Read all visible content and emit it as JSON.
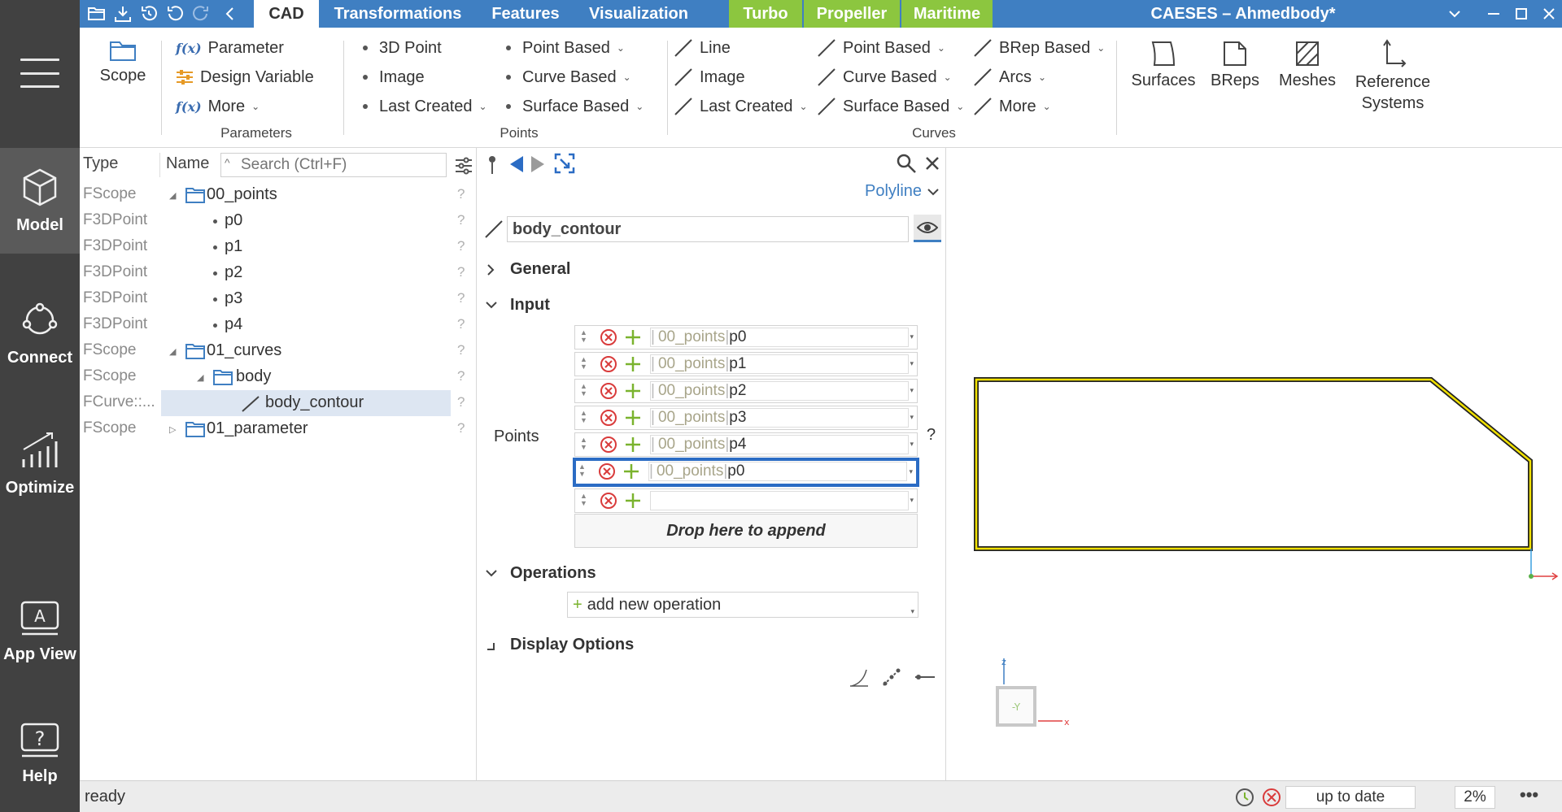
{
  "titlebar": {
    "tabs": [
      {
        "label": "CAD",
        "active": true
      },
      {
        "label": "Transformations"
      },
      {
        "label": "Features"
      },
      {
        "label": "Visualization"
      },
      {
        "label": "Turbo",
        "accent": "#8cc63f"
      },
      {
        "label": "Propeller",
        "accent": "#8cc63f"
      },
      {
        "label": "Maritime",
        "accent": "#8cc63f"
      }
    ],
    "app_title": "CAESES – Ahmedbody*",
    "quick_icons": [
      "open-folder-icon",
      "save-icon",
      "history-icon",
      "undo-icon",
      "redo-icon",
      "back-icon"
    ],
    "window_controls": [
      "chevron-down-icon",
      "minimize-icon",
      "maximize-icon",
      "close-icon"
    ],
    "bar_color": "#3f7fc2"
  },
  "sidebar": {
    "items": [
      {
        "label": "Model",
        "icon": "cube-icon",
        "active": true
      },
      {
        "label": "Connect",
        "icon": "connect-icon"
      },
      {
        "label": "Optimize",
        "icon": "chart-icon"
      },
      {
        "label": "App View",
        "icon": "app-view-icon"
      },
      {
        "label": "Help",
        "icon": "help-icon"
      }
    ]
  },
  "ribbon": {
    "scope": "Scope",
    "parameters": {
      "items": [
        "Parameter",
        "Design Variable",
        "More"
      ],
      "fx": "f(x)",
      "group": "Parameters"
    },
    "points": {
      "col1": [
        "3D Point",
        "Image",
        "Last Created"
      ],
      "col2": [
        "Point Based",
        "Curve Based",
        "Surface Based"
      ],
      "group": "Points"
    },
    "curves": {
      "col1": [
        "Line",
        "Image",
        "Last Created"
      ],
      "col2": [
        "Point Based",
        "Curve Based",
        "Surface Based"
      ],
      "col3": [
        "BRep Based",
        "Arcs",
        "More"
      ],
      "group": "Curves"
    },
    "big": [
      "Surfaces",
      "BReps",
      "Meshes",
      "Reference Systems"
    ]
  },
  "tree": {
    "col_type": "Type",
    "col_name": "Name",
    "search_placeholder": "Search (Ctrl+F)",
    "rows": [
      {
        "type": "FScope",
        "name": "00_points"
      },
      {
        "type": "F3DPoint",
        "name": "p0"
      },
      {
        "type": "F3DPoint",
        "name": "p1"
      },
      {
        "type": "F3DPoint",
        "name": "p2"
      },
      {
        "type": "F3DPoint",
        "name": "p3"
      },
      {
        "type": "F3DPoint",
        "name": "p4"
      },
      {
        "type": "FScope",
        "name": "01_curves"
      },
      {
        "type": "FScope",
        "name": "body"
      },
      {
        "type": "FCurve::...",
        "name": "body_contour"
      },
      {
        "type": "FScope",
        "name": "01_parameter"
      }
    ],
    "help_mark": "?"
  },
  "props": {
    "curve_type": "Polyline",
    "object_name": "body_contour",
    "sections": {
      "general": "General",
      "input": "Input",
      "operations": "Operations",
      "display": "Display Options"
    },
    "points_label": "Points",
    "points_help": "?",
    "points": [
      {
        "scope": "00_points",
        "value": "p0"
      },
      {
        "scope": "00_points",
        "value": "p1"
      },
      {
        "scope": "00_points",
        "value": "p2"
      },
      {
        "scope": "00_points",
        "value": "p3"
      },
      {
        "scope": "00_points",
        "value": "p4"
      },
      {
        "scope": "00_points",
        "value": "p0"
      }
    ],
    "drop_text": "Drop here to append",
    "add_operation": "add new operation"
  },
  "viewport": {
    "axis_z": "z",
    "axis_x": "x",
    "view_cube_label": "-Y",
    "curve_color": "#f0e000"
  },
  "status": {
    "text": "ready",
    "state": "up to date",
    "percent": "2%"
  }
}
